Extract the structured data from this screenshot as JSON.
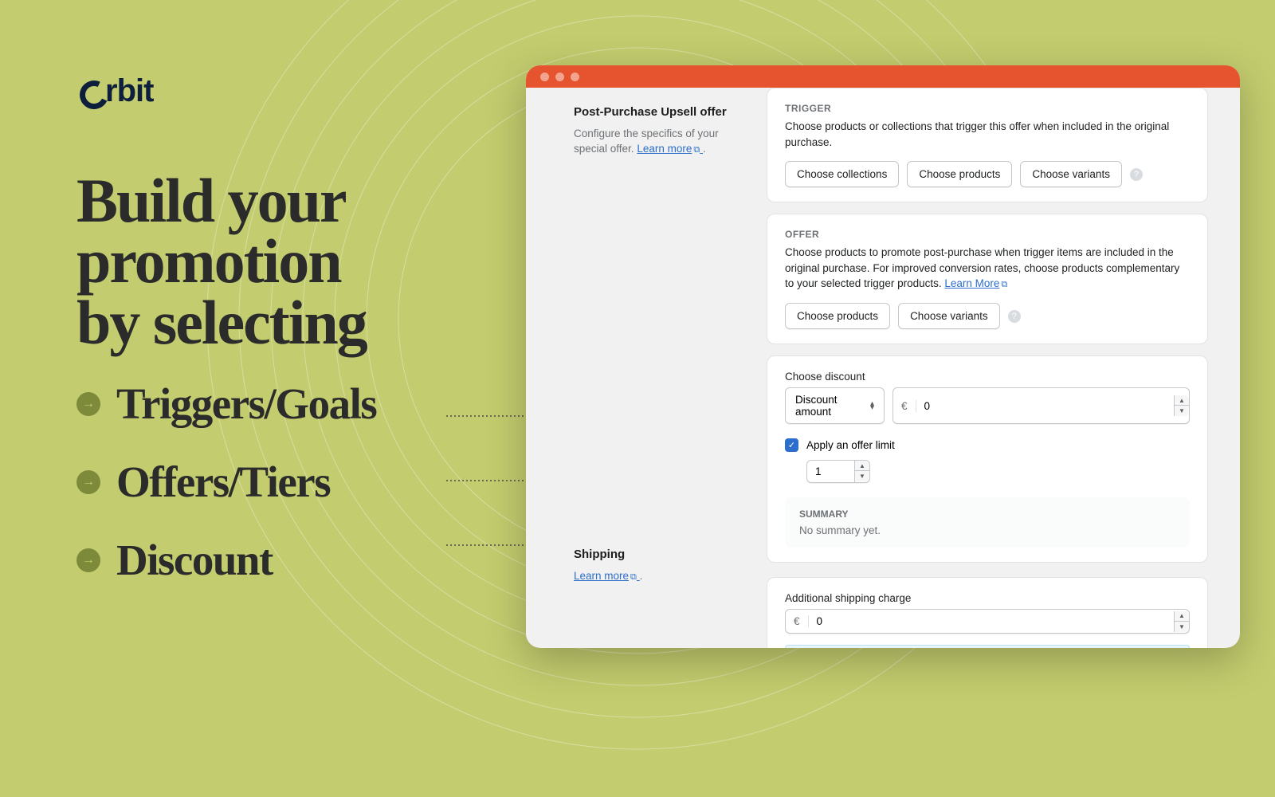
{
  "brand": "rbit",
  "headline_line1": "Build your",
  "headline_line2": "promotion",
  "headline_line3": "by selecting",
  "bullets": [
    "Triggers/Goals",
    "Offers/Tiers",
    "Discount"
  ],
  "sidebar": {
    "title": "Post-Purchase Upsell offer",
    "desc": "Configure the specifics of your special offer. ",
    "learn_more": "Learn more"
  },
  "trigger": {
    "label": "TRIGGER",
    "desc": "Choose products or collections that trigger this offer when included in the original purchase.",
    "btn_collections": "Choose collections",
    "btn_products": "Choose products",
    "btn_variants": "Choose variants"
  },
  "offer": {
    "label": "OFFER",
    "desc": "Choose products to promote post-purchase when trigger items are included in the original purchase. For improved conversion rates, choose products complementary to your selected trigger products. ",
    "learn_more": "Learn More",
    "btn_products": "Choose products",
    "btn_variants": "Choose variants"
  },
  "discount": {
    "label": "Choose discount",
    "select_value": "Discount amount",
    "currency": "€",
    "amount": "0",
    "limit_label": "Apply an offer limit",
    "limit_value": "1",
    "summary_label": "SUMMARY",
    "summary_text": "No summary yet."
  },
  "shipping": {
    "title": "Shipping",
    "learn_more": "Learn more",
    "field_label": "Additional shipping charge",
    "currency": "€",
    "amount": "0"
  }
}
